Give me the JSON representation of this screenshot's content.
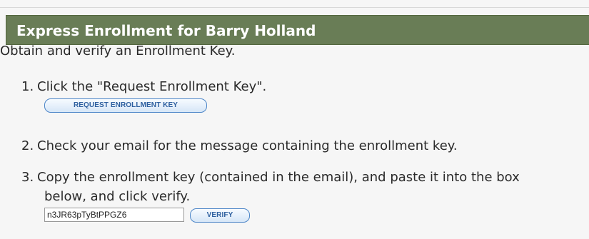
{
  "header": {
    "title": "Express Enrollment for Barry Holland"
  },
  "intro": "Obtain and verify an Enrollment Key.",
  "steps": [
    {
      "number": "1.",
      "text": "Click the \"Request Enrollment Key\".",
      "button_label": "REQUEST ENROLLMENT KEY"
    },
    {
      "number": "2.",
      "text": "Check your email for the message containing the enrollment key."
    },
    {
      "number": "3.",
      "text_line1": "Copy the enrollment key (contained in the email), and paste it into the box",
      "text_line2": "below, and click verify.",
      "input_value": "n3JR63pTyBtPPGZ6",
      "button_label": "VERIFY"
    }
  ],
  "colors": {
    "header_bg": "#697d56",
    "button_border": "#4d86c8",
    "button_text": "#2d5f9f"
  }
}
